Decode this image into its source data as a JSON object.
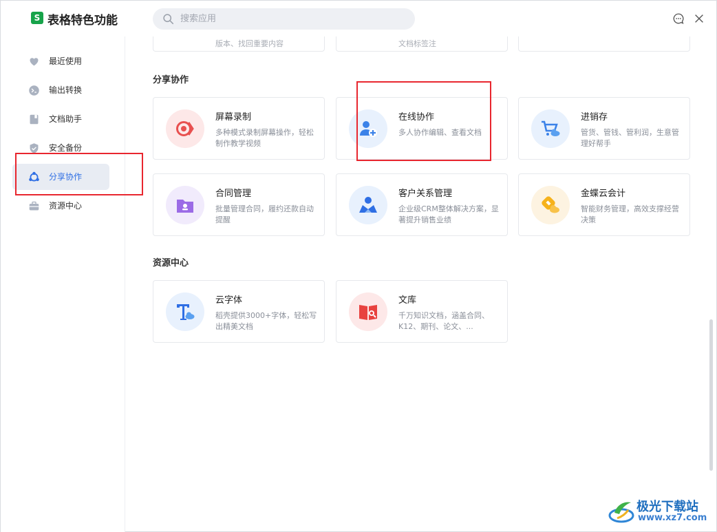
{
  "header": {
    "logo_glyph": "S",
    "title": "表格特色功能",
    "search_placeholder": "搜索应用"
  },
  "sidebar": {
    "items": [
      {
        "label": "最近使用",
        "icon": "heart-icon"
      },
      {
        "label": "输出转换",
        "icon": "convert-icon"
      },
      {
        "label": "文档助手",
        "icon": "document-icon"
      },
      {
        "label": "安全备份",
        "icon": "shield-icon"
      },
      {
        "label": "分享协作",
        "icon": "share-icon",
        "active": true
      },
      {
        "label": "资源中心",
        "icon": "briefcase-icon"
      }
    ]
  },
  "top_cards": [
    {
      "desc": "版本、找回重要内容"
    },
    {
      "desc": "文档标签注"
    },
    {
      "desc": ""
    }
  ],
  "sections": [
    {
      "title": "分享协作",
      "cards": [
        {
          "name": "屏幕录制",
          "desc": "多种模式录制屏幕操作，轻松制作教学视频",
          "icon": "screen-record-icon"
        },
        {
          "name": "在线协作",
          "desc": "多人协作编辑、查看文档",
          "icon": "online-collab-icon"
        },
        {
          "name": "进销存",
          "desc": "管货、管钱、管利润，生意管理好帮手",
          "icon": "cart-cloud-icon"
        },
        {
          "name": "合同管理",
          "desc": "批量管理合同，履约还款自动提醒",
          "icon": "contract-folder-icon"
        },
        {
          "name": "客户关系管理",
          "desc": "企业级CRM整体解决方案，显著提升销售业绩",
          "icon": "crm-icon"
        },
        {
          "name": "金蝶云会计",
          "desc": "智能财务管理，高效支撑经营决策",
          "icon": "kingdee-icon"
        }
      ]
    },
    {
      "title": "资源中心",
      "cards": [
        {
          "name": "云字体",
          "desc": "稻壳提供3000+字体，轻松写出精美文档",
          "icon": "cloud-font-icon"
        },
        {
          "name": "文库",
          "desc": "千万知识文档，涵盖合同、K12、期刊、论文、...",
          "icon": "library-icon"
        }
      ]
    }
  ],
  "watermark": {
    "text": "极光下载站",
    "url": "www.xz7.com"
  },
  "colors": {
    "accent": "#2f6fe4",
    "highlight_box": "#e8262e",
    "brand_green": "#17a34a"
  }
}
